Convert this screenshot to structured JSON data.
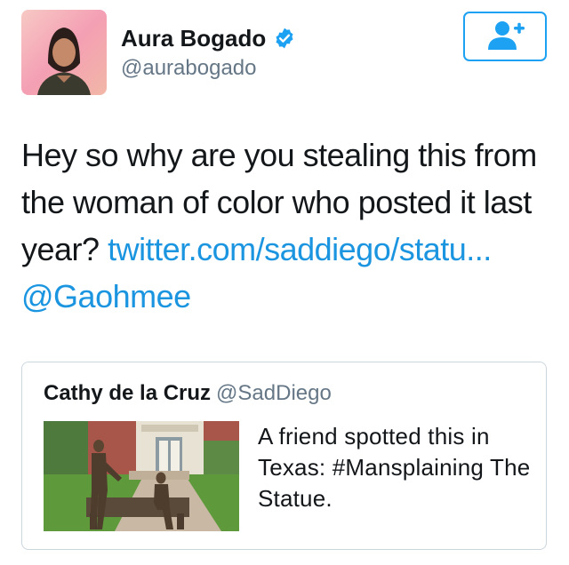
{
  "tweet": {
    "author": {
      "name": "Aura Bogado",
      "handle": "@aurabogado",
      "verified": true
    },
    "follow_button_icon": "add-user-icon",
    "text_plain": "Hey so why are you stealing this from the woman of color who posted it last year? ",
    "text_link": "twitter.com/saddiego/statu...",
    "text_mention": "@Gaohmee"
  },
  "quoted_tweet": {
    "name": "Cathy de la Cruz",
    "handle": "@SadDiego",
    "text": "A friend spotted this in Texas: #Mansplaining The Statue.",
    "media_icon": "statue-photo"
  },
  "colors": {
    "link": "#1b95e0",
    "accent": "#1da1f2",
    "secondary_text": "#657786",
    "border": "#ccd6dd"
  }
}
